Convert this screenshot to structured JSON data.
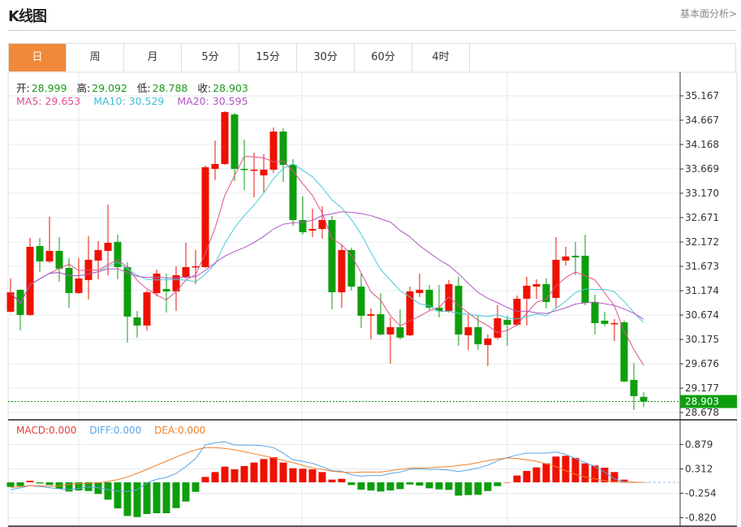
{
  "header": {
    "title": "K线图",
    "link": "基本面分析>"
  },
  "tabs": [
    {
      "label": "日",
      "active": true
    },
    {
      "label": "周"
    },
    {
      "label": "月"
    },
    {
      "label": "5分"
    },
    {
      "label": "15分"
    },
    {
      "label": "30分"
    },
    {
      "label": "60分"
    },
    {
      "label": "4时"
    }
  ],
  "quote": {
    "open_label": "开:",
    "open": "28.999",
    "high_label": "高:",
    "high": "29.092",
    "low_label": "低:",
    "low": "28.788",
    "close_label": "收:",
    "close": "28.903"
  },
  "ma_legend": {
    "ma5": "MA5: 29.653",
    "ma10": "MA10: 30.529",
    "ma20": "MA20: 30.595"
  },
  "macd_legend": {
    "macd": "MACD:0.000",
    "diff": "DIFF:0.000",
    "dea": "DEA:0.000"
  },
  "colors": {
    "up": "#ee1100",
    "down": "#0d9e0d",
    "ma5": "#e0508a",
    "ma10": "#4cc6d8",
    "ma20": "#b156c2",
    "diff": "#5aa5e6",
    "dea": "#f0802a",
    "tab_active": "#f0893a"
  },
  "chart_data": [
    {
      "type": "candlestick",
      "price_ticks": [
        "35.167",
        "34.667",
        "34.168",
        "33.669",
        "33.170",
        "32.671",
        "32.172",
        "31.673",
        "31.174",
        "30.674",
        "30.175",
        "29.676",
        "29.177",
        "28.678"
      ],
      "ylim": [
        28.678,
        35.167
      ],
      "last_price": "28.903",
      "grid": true,
      "open": [
        30.743,
        31.192,
        30.677,
        32.09,
        31.774,
        31.99,
        31.641,
        31.126,
        31.392,
        31.791,
        31.99,
        32.173,
        31.657,
        30.627,
        30.46,
        31.126,
        31.209,
        31.159,
        31.458,
        31.657,
        31.657,
        33.67,
        33.77,
        34.785,
        33.67,
        33.637,
        33.537,
        33.654,
        34.435,
        33.753,
        32.622,
        32.406,
        32.439,
        32.622,
        31.142,
        32.007,
        31.258,
        30.66,
        30.693,
        30.277,
        30.427,
        30.261,
        31.126,
        31.192,
        30.826,
        30.759,
        31.275,
        30.261,
        30.427,
        30.061,
        30.211,
        30.577,
        30.477,
        31.009,
        31.258,
        31.308,
        31.026,
        31.791,
        31.89,
        31.89,
        30.942,
        30.56,
        30.494,
        30.527,
        29.346,
        28.999
      ],
      "high": [
        31.425,
        31.2,
        32.256,
        32.256,
        32.689,
        32.273,
        31.841,
        31.841,
        32.29,
        32.19,
        32.938,
        32.323,
        31.757,
        30.759,
        31.175,
        31.608,
        31.525,
        31.674,
        32.156,
        32.007,
        33.737,
        34.252,
        34.851,
        34.818,
        34.269,
        34.003,
        33.97,
        34.518,
        34.502,
        33.87,
        33.105,
        32.855,
        32.905,
        32.705,
        32.107,
        32.057,
        31.525,
        30.81,
        31.126,
        30.627,
        30.793,
        31.258,
        31.525,
        31.292,
        31.292,
        31.391,
        31.458,
        30.677,
        30.677,
        30.277,
        30.876,
        30.66,
        31.075,
        31.458,
        31.408,
        31.425,
        32.273,
        32.073,
        32.173,
        32.323,
        31.092,
        30.743,
        30.593,
        30.56,
        29.695,
        29.092
      ],
      "low": [
        30.726,
        30.361,
        30.66,
        31.558,
        31.741,
        31.358,
        30.826,
        31.109,
        30.993,
        31.408,
        31.491,
        31.408,
        30.111,
        30.211,
        30.361,
        31.059,
        30.726,
        30.759,
        31.425,
        31.308,
        31.641,
        33.438,
        33.753,
        33.421,
        33.238,
        33.088,
        33.188,
        33.587,
        33.404,
        32.506,
        32.323,
        32.273,
        32.24,
        30.793,
        30.826,
        31.175,
        30.41,
        30.177,
        30.261,
        29.678,
        30.177,
        30.244,
        31.042,
        30.776,
        30.627,
        30.726,
        30.044,
        29.961,
        29.961,
        29.628,
        30.177,
        30.044,
        30.444,
        30.46,
        31.009,
        30.81,
        30.826,
        31.691,
        31.491,
        30.876,
        30.277,
        30.444,
        30.144,
        29.296,
        28.73,
        28.788
      ],
      "close": [
        31.142,
        30.677,
        32.073,
        31.774,
        31.99,
        31.624,
        31.126,
        31.425,
        31.807,
        32.007,
        32.156,
        31.657,
        30.643,
        30.46,
        31.142,
        31.525,
        31.159,
        31.491,
        31.657,
        31.674,
        33.704,
        33.77,
        34.835,
        33.67,
        33.654,
        33.654,
        33.654,
        34.435,
        33.753,
        32.622,
        32.373,
        32.439,
        32.622,
        31.142,
        32.007,
        31.258,
        30.66,
        30.693,
        30.277,
        30.427,
        30.211,
        31.159,
        31.192,
        30.826,
        30.759,
        31.308,
        30.277,
        30.427,
        30.078,
        30.194,
        30.61,
        30.477,
        31.009,
        31.275,
        31.308,
        30.942,
        31.807,
        31.874,
        31.857,
        30.926,
        30.51,
        30.494,
        30.51,
        29.313,
        29.013,
        28.903
      ]
    },
    {
      "type": "macd",
      "ticks": [
        "0.879",
        "0.312",
        "-0.254",
        "-0.820"
      ],
      "ylim": [
        -0.82,
        0.879
      ],
      "macd": [
        -0.107,
        -0.088,
        0.038,
        -0.025,
        -0.063,
        -0.151,
        -0.214,
        -0.189,
        -0.202,
        -0.271,
        -0.403,
        -0.605,
        -0.781,
        -0.806,
        -0.737,
        -0.718,
        -0.718,
        -0.599,
        -0.447,
        -0.221,
        0.126,
        0.239,
        0.365,
        0.302,
        0.378,
        0.46,
        0.542,
        0.586,
        0.46,
        0.328,
        0.315,
        0.302,
        0.239,
        0.063,
        0.082,
        -0.063,
        -0.17,
        -0.189,
        -0.214,
        -0.189,
        -0.158,
        -0.05,
        -0.076,
        -0.139,
        -0.164,
        -0.176,
        -0.309,
        -0.296,
        -0.29,
        -0.202,
        -0.088,
        0,
        0.158,
        0.265,
        0.347,
        0.441,
        0.599,
        0.617,
        0.567,
        0.441,
        0.391,
        0.34,
        0.239,
        0.063,
        0.013,
        0
      ],
      "diff": [
        -0.17,
        -0.13,
        -0.076,
        -0.1,
        -0.126,
        -0.15,
        -0.17,
        -0.14,
        -0.107,
        -0.126,
        -0.17,
        -0.202,
        -0.214,
        -0.17,
        -0.013,
        0.07,
        0.113,
        0.208,
        0.365,
        0.554,
        0.869,
        0.92,
        0.945,
        0.869,
        0.869,
        0.863,
        0.85,
        0.806,
        0.68,
        0.523,
        0.491,
        0.441,
        0.365,
        0.271,
        0.258,
        0.176,
        0.145,
        0.158,
        0.158,
        0.208,
        0.239,
        0.302,
        0.315,
        0.302,
        0.302,
        0.284,
        0.252,
        0.284,
        0.334,
        0.397,
        0.504,
        0.573,
        0.636,
        0.68,
        0.68,
        0.68,
        0.706,
        0.649,
        0.554,
        0.46,
        0.365,
        0.239,
        0.082,
        0.013,
        0,
        0
      ],
      "dea": [
        -0.12,
        -0.1,
        -0.076,
        -0.08,
        -0.095,
        -0.08,
        -0.044,
        -0.03,
        -0.025,
        -0.013,
        0.019,
        0.063,
        0.126,
        0.208,
        0.302,
        0.397,
        0.491,
        0.586,
        0.68,
        0.756,
        0.806,
        0.806,
        0.788,
        0.756,
        0.712,
        0.662,
        0.617,
        0.567,
        0.51,
        0.46,
        0.397,
        0.334,
        0.302,
        0.258,
        0.239,
        0.227,
        0.239,
        0.239,
        0.239,
        0.271,
        0.302,
        0.328,
        0.334,
        0.34,
        0.353,
        0.365,
        0.391,
        0.416,
        0.46,
        0.504,
        0.541,
        0.567,
        0.554,
        0.523,
        0.491,
        0.428,
        0.365,
        0.271,
        0.189,
        0.126,
        0.082,
        0.038,
        0.013,
        0,
        0,
        0
      ]
    }
  ]
}
